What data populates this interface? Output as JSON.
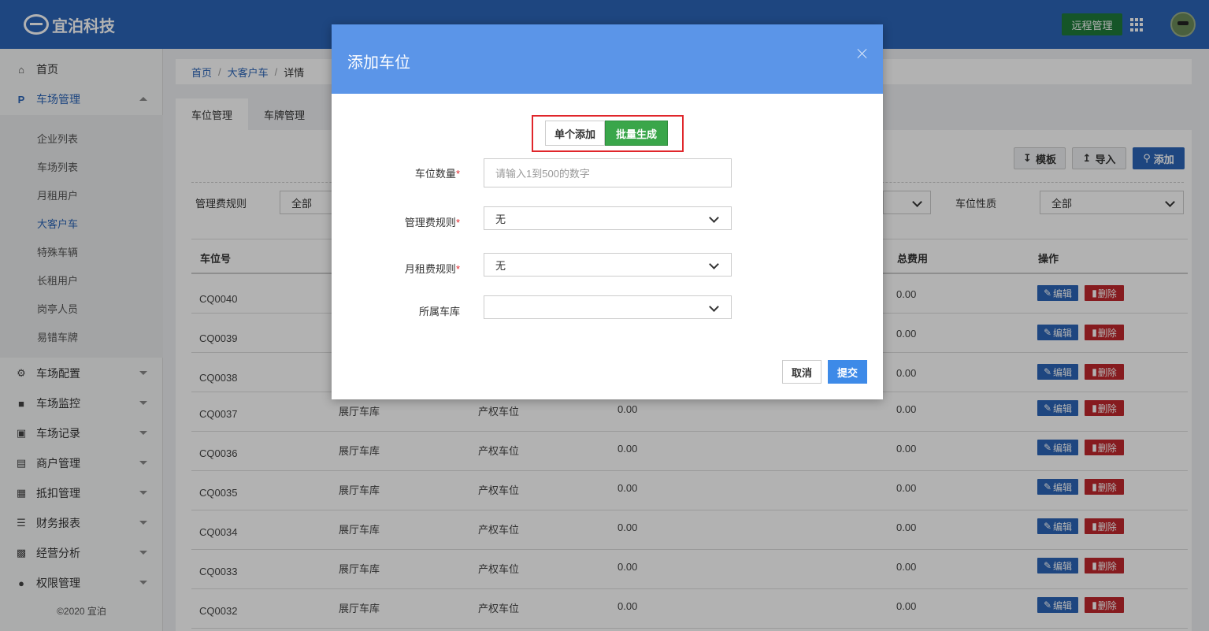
{
  "app": {
    "brand": "宜泊科技",
    "remote_label": "远程管理"
  },
  "sidebar": {
    "items": [
      {
        "label": "首页",
        "icon": "home-icon"
      },
      {
        "label": "车场管理",
        "icon": "parking-icon"
      },
      {
        "label": "车场配置",
        "icon": "gear-icon"
      },
      {
        "label": "车场监控",
        "icon": "camera-icon"
      },
      {
        "label": "车场记录",
        "icon": "chart-icon"
      },
      {
        "label": "商户管理",
        "icon": "store-icon"
      },
      {
        "label": "抵扣管理",
        "icon": "ticket-icon"
      },
      {
        "label": "财务报表",
        "icon": "list-icon"
      },
      {
        "label": "经营分析",
        "icon": "bar-chart-icon"
      },
      {
        "label": "权限管理",
        "icon": "users-icon"
      }
    ],
    "sub_items": [
      "企业列表",
      "车场列表",
      "月租用户",
      "大客户车",
      "特殊车辆",
      "长租用户",
      "岗亭人员",
      "易错车牌"
    ],
    "active_sub": "大客户车",
    "copyright": "©2020 宜泊"
  },
  "breadcrumb": {
    "home": "首页",
    "parent": "大客户车",
    "current": "详情",
    "sep": "/"
  },
  "tabs": [
    "车位管理",
    "车牌管理"
  ],
  "toolbar": {
    "template": "模板",
    "import": "导入",
    "add": "添加"
  },
  "filters": {
    "fee_rule_label": "管理费规则",
    "fee_rule_value": "全部",
    "nature_label": "车位性质",
    "nature_value": "全部"
  },
  "table": {
    "headers": [
      "车位号",
      "总费用",
      "操作"
    ],
    "edit_label": "编辑",
    "delete_label": "删除",
    "rows": [
      {
        "no": "CQ0040",
        "garage": "",
        "type": "",
        "fee": "",
        "total": "0.00"
      },
      {
        "no": "CQ0039",
        "garage": "",
        "type": "",
        "fee": "",
        "total": "0.00"
      },
      {
        "no": "CQ0038",
        "garage": "",
        "type": "",
        "fee": "",
        "total": "0.00"
      },
      {
        "no": "CQ0037",
        "garage": "展厅车库",
        "type": "产权车位",
        "fee": "0.00",
        "total": "0.00"
      },
      {
        "no": "CQ0036",
        "garage": "展厅车库",
        "type": "产权车位",
        "fee": "0.00",
        "total": "0.00"
      },
      {
        "no": "CQ0035",
        "garage": "展厅车库",
        "type": "产权车位",
        "fee": "0.00",
        "total": "0.00"
      },
      {
        "no": "CQ0034",
        "garage": "展厅车库",
        "type": "产权车位",
        "fee": "0.00",
        "total": "0.00"
      },
      {
        "no": "CQ0033",
        "garage": "展厅车库",
        "type": "产权车位",
        "fee": "0.00",
        "total": "0.00"
      },
      {
        "no": "CQ0032",
        "garage": "展厅车库",
        "type": "产权车位",
        "fee": "0.00",
        "total": "0.00"
      }
    ]
  },
  "modal": {
    "title": "添加车位",
    "toggle_single": "单个添加",
    "toggle_batch": "批量生成",
    "count_label": "车位数量",
    "count_placeholder": "请输入1到500的数字",
    "fee_label": "管理费规则",
    "fee_value": "无",
    "rent_label": "月租费规则",
    "rent_value": "无",
    "garage_label": "所属车库",
    "garage_value": "",
    "required_mark": "*",
    "cancel": "取消",
    "submit": "提交"
  }
}
